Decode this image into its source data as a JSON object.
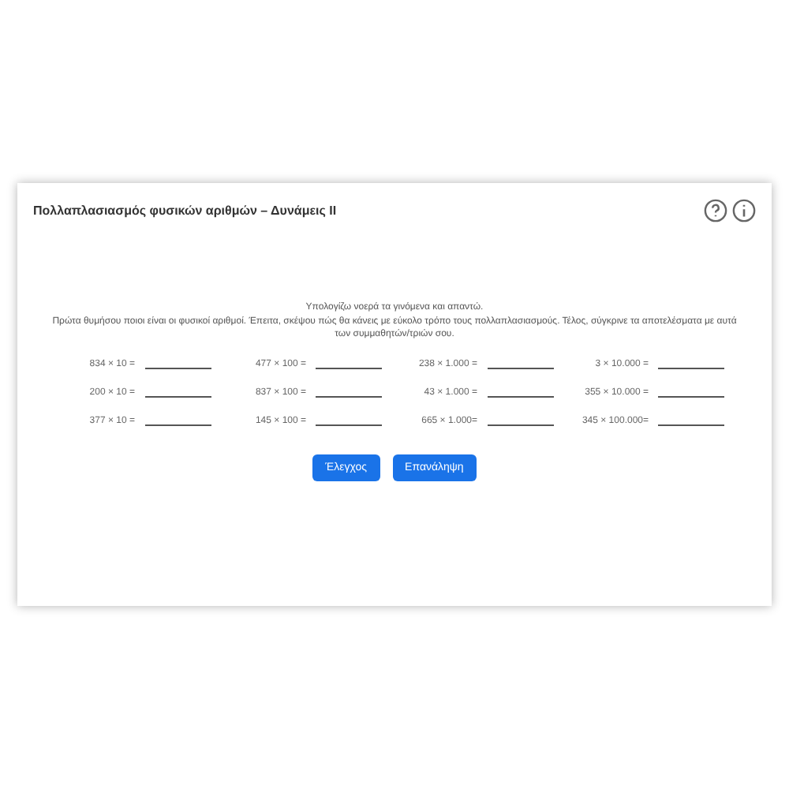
{
  "title": "Πολλαπλασιασμός φυσικών αριθμών – Δυνάμεις ΙΙ",
  "instructions": [
    "Υπολογίζω νοερά τα γινόμενα και απαντώ.",
    "Πρώτα θυμήσου ποιοι είναι οι φυσικοί αριθμοί. Έπειτα, σκέψου πώς θα κάνεις με εύκολο τρόπο τους πολλαπλασιασμούς. Τέλος, σύγκρινε τα αποτελέσματα με αυτά των συμμαθητών/τριών σου."
  ],
  "problems": [
    {
      "expression": "834 × 10 ="
    },
    {
      "expression": "477 × 100 ="
    },
    {
      "expression": "238 × 1.000 ="
    },
    {
      "expression": "3 × 10.000 ="
    },
    {
      "expression": "200 × 10 ="
    },
    {
      "expression": "837 × 100 ="
    },
    {
      "expression": "43 × 1.000 ="
    },
    {
      "expression": "355 × 10.000 ="
    },
    {
      "expression": "377 × 10 ="
    },
    {
      "expression": "145 × 100 ="
    },
    {
      "expression": "665 × 1.000="
    },
    {
      "expression": "345 × 100.000="
    }
  ],
  "buttons": [
    "Έλεγχος",
    "Επανάληψη"
  ]
}
